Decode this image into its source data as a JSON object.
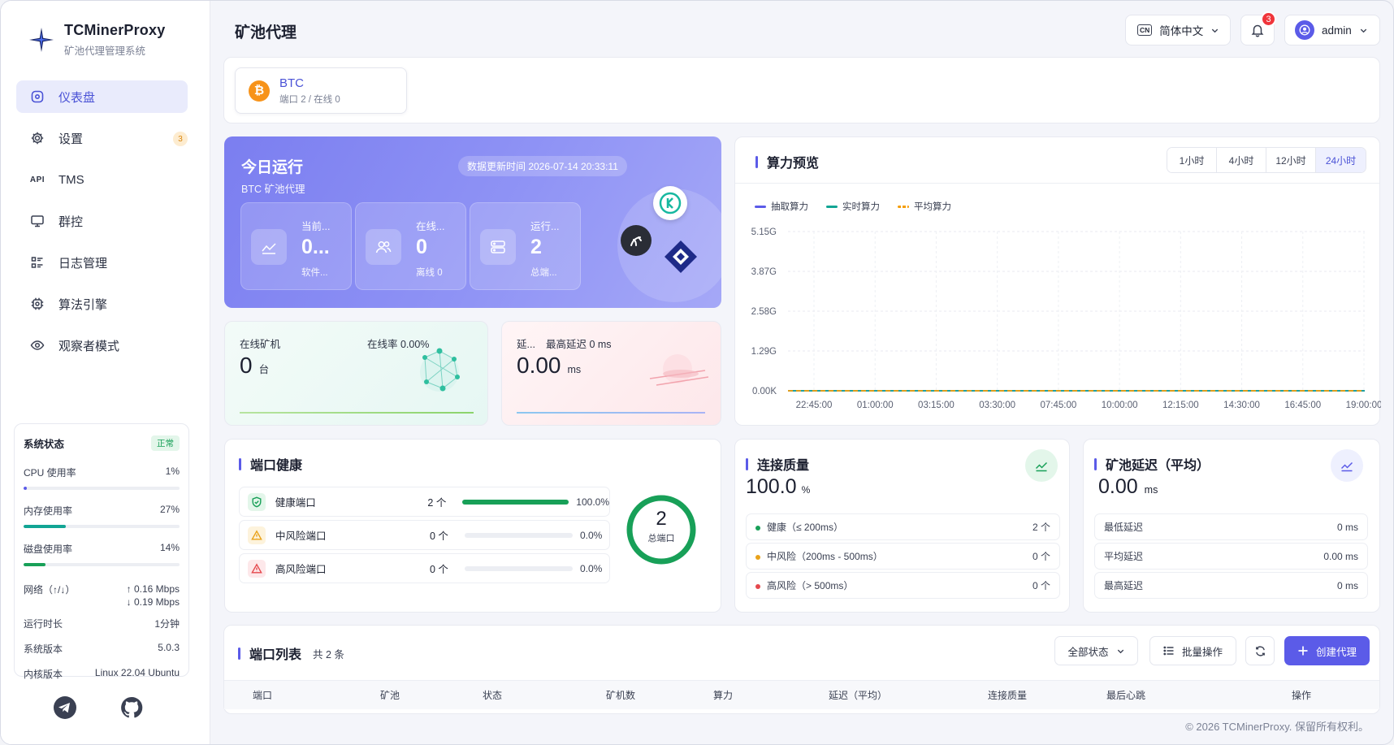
{
  "brand": {
    "title": "TCMinerProxy",
    "subtitle": "矿池代理管理系统"
  },
  "nav": [
    {
      "label": "仪表盘",
      "icon": "dashboard-icon",
      "active": true
    },
    {
      "label": "设置",
      "icon": "gear-icon",
      "badge": "3"
    },
    {
      "label": "TMS",
      "icon": "api-icon",
      "icon_text": "API"
    },
    {
      "label": "群控",
      "icon": "monitor-icon"
    },
    {
      "label": "日志管理",
      "icon": "log-list-icon"
    },
    {
      "label": "算法引擎",
      "icon": "chip-icon"
    },
    {
      "label": "观察者模式",
      "icon": "eye-icon"
    }
  ],
  "system": {
    "title": "系统状态",
    "status": "正常",
    "cpu": {
      "label": "CPU 使用率",
      "value": "1%",
      "percent": 1
    },
    "mem": {
      "label": "内存使用率",
      "value": "27%",
      "percent": 27
    },
    "disk": {
      "label": "磁盘使用率",
      "value": "14%",
      "percent": 14
    },
    "net_label": "网络（↑/↓）",
    "net_up": "↑ 0.16 Mbps",
    "net_down": "↓ 0.19 Mbps",
    "uptime_label": "运行时长",
    "uptime": "1分钟",
    "version_label": "系统版本",
    "version": "5.0.3",
    "kernel_label": "内核版本",
    "kernel": "Linux 22.04 Ubuntu"
  },
  "topbar": {
    "page_title": "矿池代理",
    "lang_badge": "CN",
    "lang": "简体中文",
    "notifications": "3",
    "user": "admin"
  },
  "coin": {
    "name": "BTC",
    "symbol": "₿",
    "sub": "端口 2 / 在线 0"
  },
  "today": {
    "title": "今日运行",
    "subtitle": "BTC 矿池代理",
    "updated": "数据更新时间 2026-07-14 20:33:11",
    "cards": [
      {
        "label": "当前...",
        "value": "0...",
        "sub": "软件..."
      },
      {
        "label": "在线...",
        "value": "0",
        "sub": "离线 0"
      },
      {
        "label": "运行...",
        "value": "2",
        "sub": "总端..."
      }
    ]
  },
  "online": {
    "label": "在线矿机",
    "rate": "在线率 0.00%",
    "value": "0",
    "unit": "台"
  },
  "latency": {
    "label": "延...",
    "max": "最高延迟 0 ms",
    "value": "0.00",
    "unit": "ms"
  },
  "hashrate": {
    "title": "算力预览",
    "ranges": [
      "1小时",
      "4小时",
      "12小时",
      "24小时"
    ],
    "active_range": "24小时"
  },
  "chart_data": {
    "type": "line",
    "title": "算力预览",
    "x": [
      "22:45:00",
      "01:00:00",
      "03:15:00",
      "03:30:00",
      "07:45:00",
      "10:00:00",
      "12:15:00",
      "14:30:00",
      "16:45:00",
      "19:00:00"
    ],
    "y_ticks": [
      "0.00K",
      "1.29G",
      "2.58G",
      "3.87G",
      "5.15G"
    ],
    "ylim": [
      0,
      5.15
    ],
    "series": [
      {
        "name": "抽取算力",
        "color": "#5b5be8",
        "values": [
          0,
          0,
          0,
          0,
          0,
          0,
          0,
          0,
          0,
          0
        ]
      },
      {
        "name": "实时算力",
        "color": "#12a594",
        "values": [
          0,
          0,
          0,
          0,
          0,
          0,
          0,
          0,
          0,
          0
        ]
      },
      {
        "name": "平均算力",
        "color": "#f59e0b",
        "values": [
          0,
          0,
          0,
          0,
          0,
          0,
          0,
          0,
          0,
          0
        ],
        "dashed": true
      }
    ],
    "grid": true,
    "legend": "top-left"
  },
  "port_health": {
    "title": "端口健康",
    "rows": [
      {
        "label": "健康端口",
        "count": "2 个",
        "percent_text": "100.0%",
        "percent": 100,
        "color": "#18a058",
        "bg": "#e3f6ea",
        "icon": "shield-check-icon"
      },
      {
        "label": "中风险端口",
        "count": "0 个",
        "percent_text": "0.0%",
        "percent": 0,
        "color": "#e9a21a",
        "bg": "#fdf3dc",
        "icon": "warning-icon"
      },
      {
        "label": "高风险端口",
        "count": "0 个",
        "percent_text": "0.0%",
        "percent": 0,
        "color": "#e5484d",
        "bg": "#fde8ea",
        "icon": "alert-triangle-icon"
      }
    ],
    "total": "2",
    "total_label": "总端口"
  },
  "connection": {
    "title": "连接质量",
    "value": "100.0",
    "unit": "%",
    "rows": [
      {
        "label": "健康（≤ 200ms）",
        "count": "2 个",
        "color": "#18a058"
      },
      {
        "label": "中风险（200ms - 500ms）",
        "count": "0 个",
        "color": "#e9a21a"
      },
      {
        "label": "高风险（> 500ms）",
        "count": "0 个",
        "color": "#e5484d"
      }
    ]
  },
  "pool_latency": {
    "title": "矿池延迟（平均）",
    "value": "0.00",
    "unit": "ms",
    "rows": [
      {
        "label": "最低延迟",
        "value": "0 ms"
      },
      {
        "label": "平均延迟",
        "value": "0.00 ms"
      },
      {
        "label": "最高延迟",
        "value": "0 ms"
      }
    ]
  },
  "port_list": {
    "title": "端口列表",
    "count": "共 2 条",
    "filter": "全部状态",
    "batch": "批量操作",
    "create": "创建代理",
    "columns": [
      "端口",
      "矿池",
      "状态",
      "矿机数",
      "算力",
      "延迟（平均）",
      "连接质量",
      "最后心跳",
      "操作"
    ]
  },
  "footer": "© 2026 TCMinerProxy. 保留所有权利。"
}
